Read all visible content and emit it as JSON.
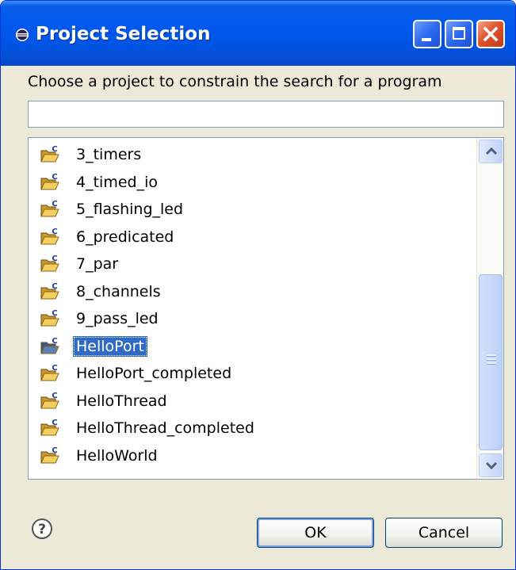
{
  "window": {
    "title": "Project Selection",
    "title_icon": "eclipse-icon",
    "controls": [
      "minimize",
      "maximize",
      "close"
    ]
  },
  "instruction": "Choose a project to constrain the search for a program",
  "filter": {
    "value": "",
    "placeholder": ""
  },
  "projects": [
    {
      "label": "3_timers",
      "icon": "c-project-folder-icon"
    },
    {
      "label": "4_timed_io",
      "icon": "c-project-folder-icon"
    },
    {
      "label": "5_flashing_led",
      "icon": "c-project-folder-icon"
    },
    {
      "label": "6_predicated",
      "icon": "c-project-folder-icon"
    },
    {
      "label": "7_par",
      "icon": "c-project-folder-icon"
    },
    {
      "label": "8_channels",
      "icon": "c-project-folder-icon"
    },
    {
      "label": "9_pass_led",
      "icon": "c-project-folder-icon"
    },
    {
      "label": "HelloPort",
      "icon": "c-project-folder-icon",
      "selected": true
    },
    {
      "label": "HelloPort_completed",
      "icon": "c-project-folder-icon"
    },
    {
      "label": "HelloThread",
      "icon": "c-project-folder-icon"
    },
    {
      "label": "HelloThread_completed",
      "icon": "c-project-folder-icon"
    },
    {
      "label": "HelloWorld",
      "icon": "c-project-folder-icon"
    }
  ],
  "buttons": {
    "ok": "OK",
    "cancel": "Cancel"
  },
  "colors": {
    "titlebar": "#0054e3",
    "selection": "#316ac5",
    "dialog_bg": "#ece9d8"
  }
}
